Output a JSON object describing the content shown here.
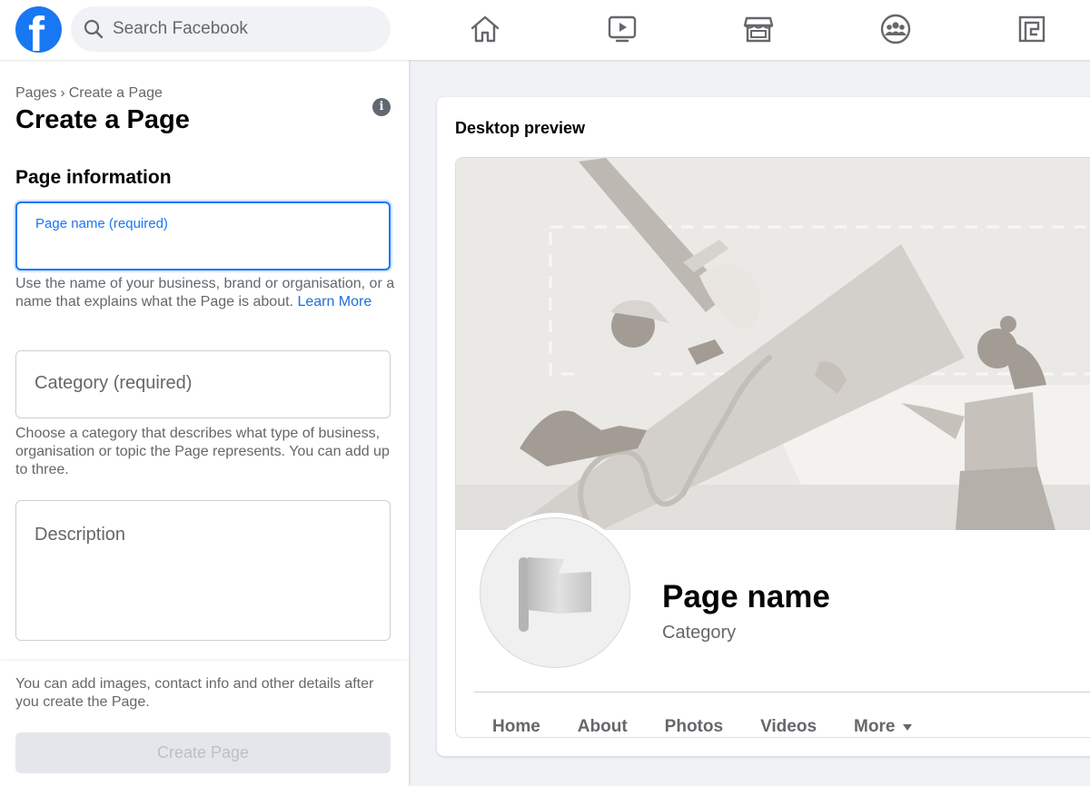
{
  "topbar": {
    "logo_letter": "f",
    "search_placeholder": "Search Facebook",
    "nav_icons": [
      "home-icon",
      "watch-icon",
      "marketplace-icon",
      "groups-icon",
      "gaming-icon"
    ]
  },
  "left": {
    "breadcrumb": [
      "Pages",
      "Create a Page"
    ],
    "breadcrumb_separator": "›",
    "title": "Create a Page",
    "info_glyph": "i",
    "section_title": "Page information",
    "name_field": {
      "label": "Page name (required)",
      "value": ""
    },
    "name_help": "Use the name of your business, brand or organisation, or a name that explains what the Page is about.",
    "name_help_link": "Learn More",
    "category_field": {
      "placeholder": "Category (required)"
    },
    "category_help": "Choose a category that describes what type of business, organisation or topic the Page represents. You can add up to three.",
    "description_field": {
      "placeholder": "Description"
    },
    "footer_text": "You can add images, contact info and other details after you create the Page.",
    "create_button": "Create Page"
  },
  "preview": {
    "title": "Desktop preview",
    "page_name": "Page name",
    "category": "Category",
    "tabs": [
      "Home",
      "About",
      "Photos",
      "Videos",
      "More"
    ]
  },
  "colors": {
    "brand": "#1877f2",
    "link": "#216fdb",
    "muted_text": "#65676b"
  }
}
